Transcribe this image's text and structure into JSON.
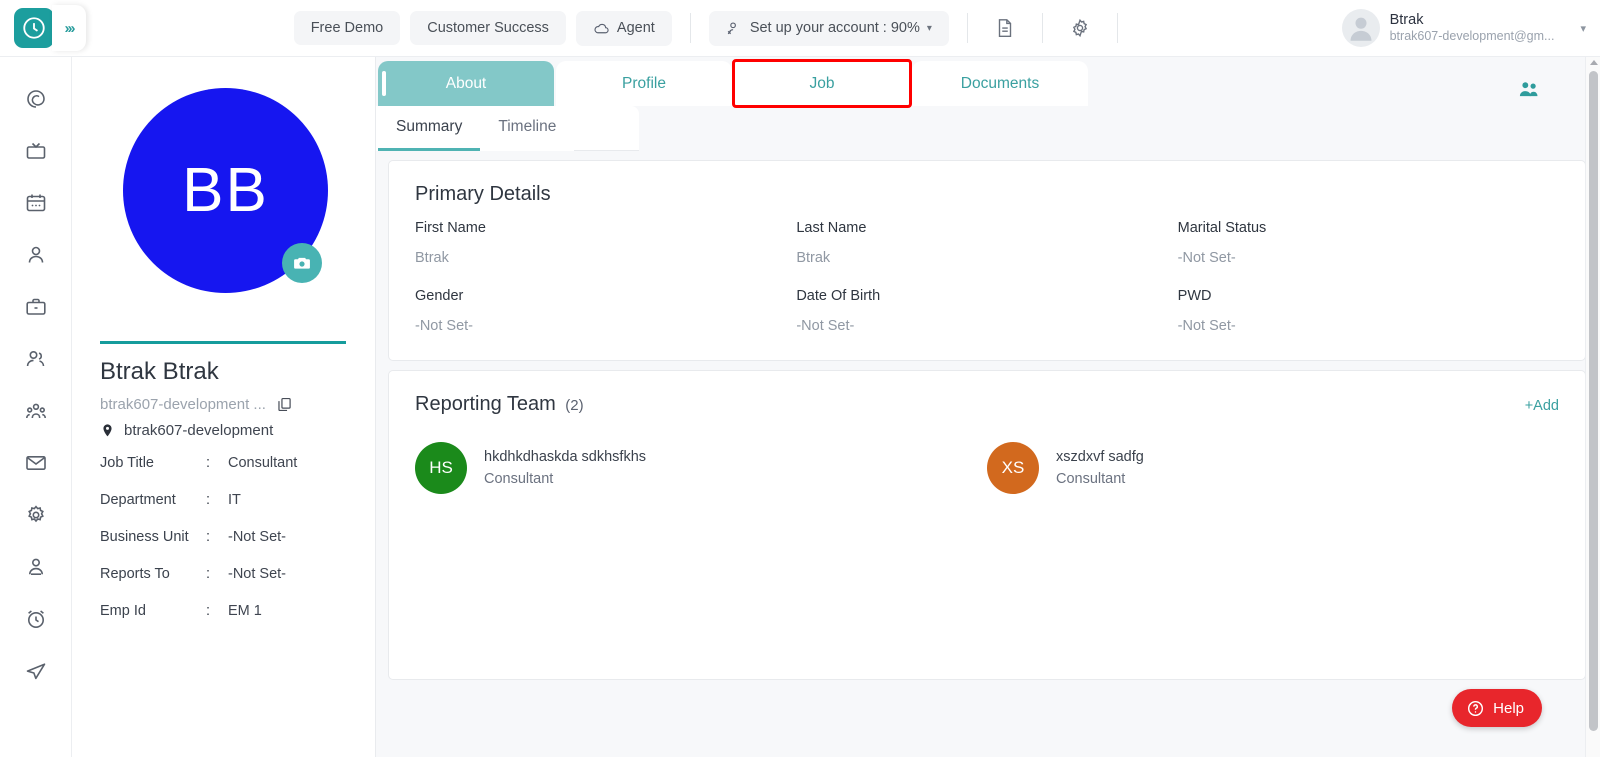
{
  "topbar": {
    "logo_icon": "clock-logo-icon",
    "expander_icon": "chevrons-right-icon",
    "expander_label": "›››",
    "buttons": [
      {
        "label": "Free Demo",
        "icon": null
      },
      {
        "label": "Customer Success",
        "icon": null
      },
      {
        "label": "Agent",
        "icon": "cloud-icon"
      }
    ],
    "setup": {
      "label": "Set up your account : 90%",
      "icon": "user-check-icon",
      "caret": "▾"
    },
    "doc_icon": "document-icon",
    "gear_icon": "gear-icon",
    "user": {
      "name": "Btrak",
      "email": "btrak607-development@gm...",
      "avatar_icon": "user-avatar-icon",
      "caret": "▾"
    }
  },
  "rail": {
    "items": [
      {
        "icon": "dashboard-spiral-icon",
        "name": "dashboard"
      },
      {
        "icon": "broadcast-tv-icon",
        "name": "broadcast"
      },
      {
        "icon": "calendar-icon",
        "name": "calendar"
      },
      {
        "icon": "person-icon",
        "name": "employee"
      },
      {
        "icon": "briefcase-icon",
        "name": "jobs"
      },
      {
        "icon": "users-icon",
        "name": "teams"
      },
      {
        "icon": "org-group-icon",
        "name": "organization"
      },
      {
        "icon": "mail-icon",
        "name": "mail"
      },
      {
        "icon": "gear-icon",
        "name": "settings"
      },
      {
        "icon": "user-circle-icon",
        "name": "profile"
      },
      {
        "icon": "alarm-clock-icon",
        "name": "attendance"
      },
      {
        "icon": "paper-plane-icon",
        "name": "send"
      }
    ]
  },
  "profile": {
    "avatar_initials": "BB",
    "avatar_color": "#1616f0",
    "camera_icon": "camera-icon",
    "name": "Btrak Btrak",
    "email": "btrak607-development ...",
    "copy_icon": "copy-icon",
    "location_icon": "location-pin-icon",
    "location": "btrak607-development",
    "fields": [
      {
        "label": "Job Title",
        "sep": ":",
        "value": "Consultant"
      },
      {
        "label": "Department",
        "sep": ":",
        "value": "IT"
      },
      {
        "label": "Business Unit",
        "sep": ":",
        "value": "-Not Set-"
      },
      {
        "label": "Reports To",
        "sep": ":",
        "value": "-Not Set-"
      },
      {
        "label": "Emp Id",
        "sep": ":",
        "value": "EM 1"
      }
    ]
  },
  "tabs": [
    {
      "label": "About",
      "active": true,
      "highlighted": false
    },
    {
      "label": "Profile",
      "active": false,
      "highlighted": false
    },
    {
      "label": "Job",
      "active": false,
      "highlighted": true
    },
    {
      "label": "Documents",
      "active": false,
      "highlighted": false
    }
  ],
  "subtabs": [
    {
      "label": "Summary",
      "active": true
    },
    {
      "label": "Timeline",
      "active": false
    }
  ],
  "people_icon": "people-group-icon",
  "primary_details": {
    "title": "Primary Details",
    "fields": [
      {
        "label": "First Name",
        "value": "Btrak"
      },
      {
        "label": "Last Name",
        "value": "Btrak"
      },
      {
        "label": "Marital Status",
        "value": "-Not Set-"
      },
      {
        "label": "Gender",
        "value": "-Not Set-"
      },
      {
        "label": "Date Of Birth",
        "value": "-Not Set-"
      },
      {
        "label": "PWD",
        "value": "-Not Set-"
      }
    ]
  },
  "reporting_team": {
    "title": "Reporting Team",
    "count": "(2)",
    "add_label": "+Add",
    "members": [
      {
        "initials": "HS",
        "color": "#1b8a1b",
        "name": "hkdhkdhaskda sdkhsfkhs",
        "role": "Consultant"
      },
      {
        "initials": "XS",
        "color": "#d2691e",
        "name": "xszdxvf sadfg",
        "role": "Consultant"
      }
    ]
  },
  "help": {
    "label": "Help",
    "icon": "question-circle-icon",
    "color": "#e8262c"
  }
}
